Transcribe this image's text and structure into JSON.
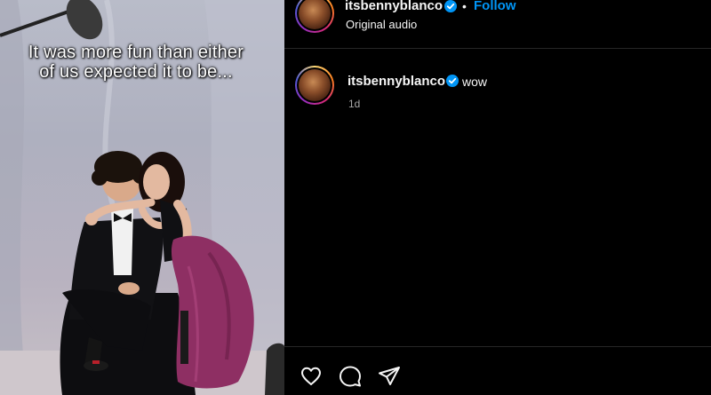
{
  "media": {
    "caption_line1": "It was more fun than either",
    "caption_line2": "of us expected it to be..."
  },
  "post_header": {
    "username": "itsbennyblanco",
    "verified": true,
    "separator": "•",
    "follow_label": "Follow",
    "audio_label": "Original audio"
  },
  "comment": {
    "username": "itsbennyblanco",
    "verified": true,
    "text": "wow",
    "time": "1d"
  },
  "actions": {
    "icons": [
      "heart-icon",
      "comment-icon",
      "share-icon"
    ]
  },
  "colors": {
    "background": "#000000",
    "link_blue": "#0095f6",
    "verified_blue": "#0095f6",
    "muted_text": "#a8a8a8"
  }
}
